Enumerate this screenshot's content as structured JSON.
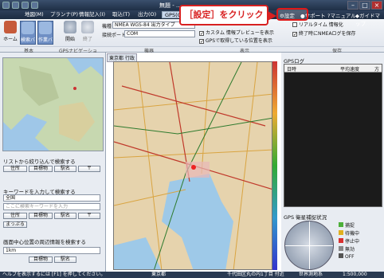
{
  "window": {
    "title": "無題 - ..."
  },
  "menu": {
    "items": [
      "地図(M)",
      "プランナ(P)",
      "情報記入(I)",
      "取込(T)",
      "出力(O)",
      "GPS(G)"
    ],
    "active_index": 5
  },
  "ribbon": {
    "buttons": {
      "home": "ホーム",
      "search": "検索バー",
      "work": "作業バー",
      "open": "開始",
      "end": "終了"
    },
    "model_label": "機種",
    "model_value": "NMEA WGS-84 出力タイプ",
    "port_label": "接続ポート",
    "port_value": "COM",
    "checks": {
      "custom_preview": "カスタム 情報プレビューを表示",
      "gps_pos": "GPSで取得している位置を表示",
      "realtime": "リアルタイム 情報化",
      "nmea_save": "終了時にNMEAログを保存"
    },
    "top_right": {
      "settings": "設定",
      "support": "サポート",
      "manual": "マニュアル",
      "guide": "ガイドマップ"
    },
    "groups": [
      "基本",
      "GPSナビゲーション",
      "機器",
      "表示",
      "保存"
    ]
  },
  "annotation": {
    "callout_text": "［設定］をクリック"
  },
  "left": {
    "list_search_label": "リストから絞り込んで検索する",
    "keyword_search_label": "キーワードを入力して検索する",
    "keyword_select": "全国",
    "keyword_placeholder": "ここに検索キーワードを入力",
    "nearby_label": "画面中心位置の周辺情報を検索する",
    "nearby_distance": "1km",
    "btn_address": "住所",
    "btn_landmark": "目標物",
    "btn_station": "駅名",
    "btn_postal": "〒",
    "btn_map_code": "まっぷる",
    "btn_nearby_landmark": "目標物",
    "btn_nearby_station": "駅名"
  },
  "map": {
    "tab": "東京都",
    "tab2": "行政"
  },
  "right": {
    "gps_log_title": "GPSログ",
    "columns": [
      "日時",
      "平均速度",
      "方"
    ],
    "satellite_title": "GPS 衛星補捉状況",
    "legend": [
      {
        "label": "捕捉",
        "color": "#4caf3a"
      },
      {
        "label": "待機中",
        "color": "#e0b020"
      },
      {
        "label": "停止中",
        "color": "#d83030"
      },
      {
        "label": "無効",
        "color": "#888888"
      },
      {
        "label": "OFF",
        "color": "#555555"
      }
    ]
  },
  "status": {
    "help": "ヘルプを表示するには [F1] を押してください。",
    "location": "東京都",
    "address": "千代田区丸の内1丁目 付近",
    "datum": "世界測地系",
    "scale": "1:500,000"
  }
}
